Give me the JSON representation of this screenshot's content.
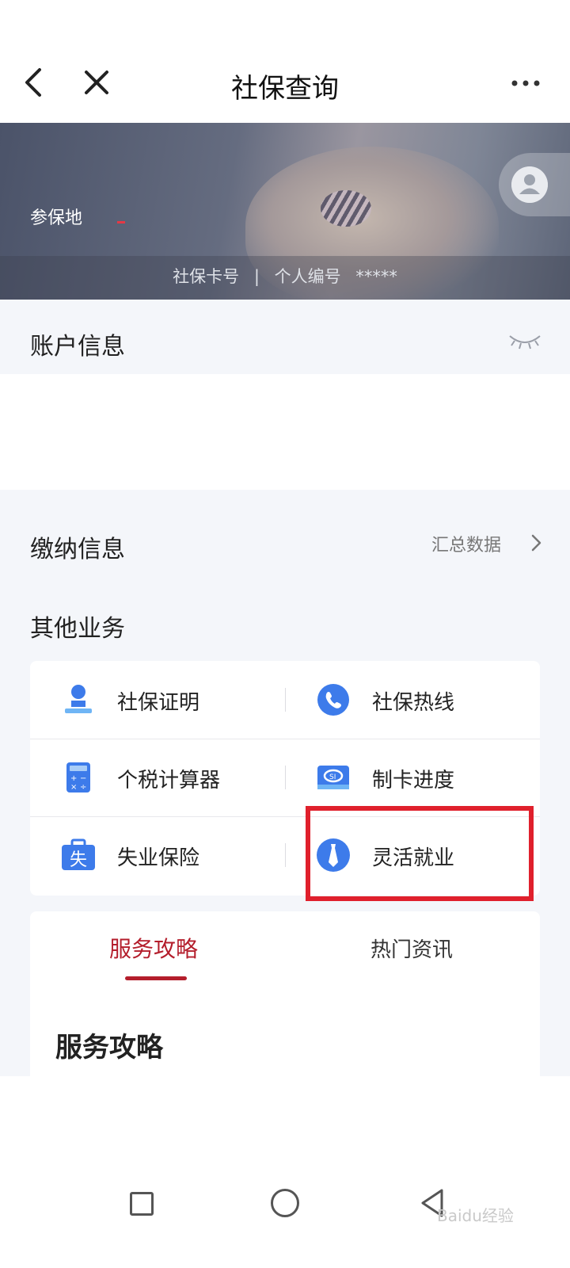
{
  "nav": {
    "title": "社保查询"
  },
  "banner": {
    "region_label": "参保地",
    "card_label": "社保卡号",
    "separator": "|",
    "id_label": "个人编号",
    "id_value": "*****"
  },
  "account": {
    "label": "账户信息"
  },
  "payment": {
    "label": "缴纳信息",
    "summary_link": "汇总数据"
  },
  "other": {
    "label": "其他业务",
    "items": [
      {
        "label": "社保证明",
        "icon": "person-stamp-icon"
      },
      {
        "label": "社保热线",
        "icon": "phone-icon"
      },
      {
        "label": "个税计算器",
        "icon": "calculator-icon"
      },
      {
        "label": "制卡进度",
        "icon": "social-security-card-icon"
      },
      {
        "label": "失业保险",
        "icon": "unemployment-briefcase-icon"
      },
      {
        "label": "灵活就业",
        "icon": "tie-icon"
      }
    ]
  },
  "tabs": {
    "active": "服务攻略",
    "other": "热门资讯"
  },
  "guide": {
    "title": "服务攻略"
  },
  "watermark": "Baidu经验",
  "colors": {
    "accent": "#b41e2c",
    "icon_blue": "#3d7bea",
    "highlight": "#e0202c"
  }
}
